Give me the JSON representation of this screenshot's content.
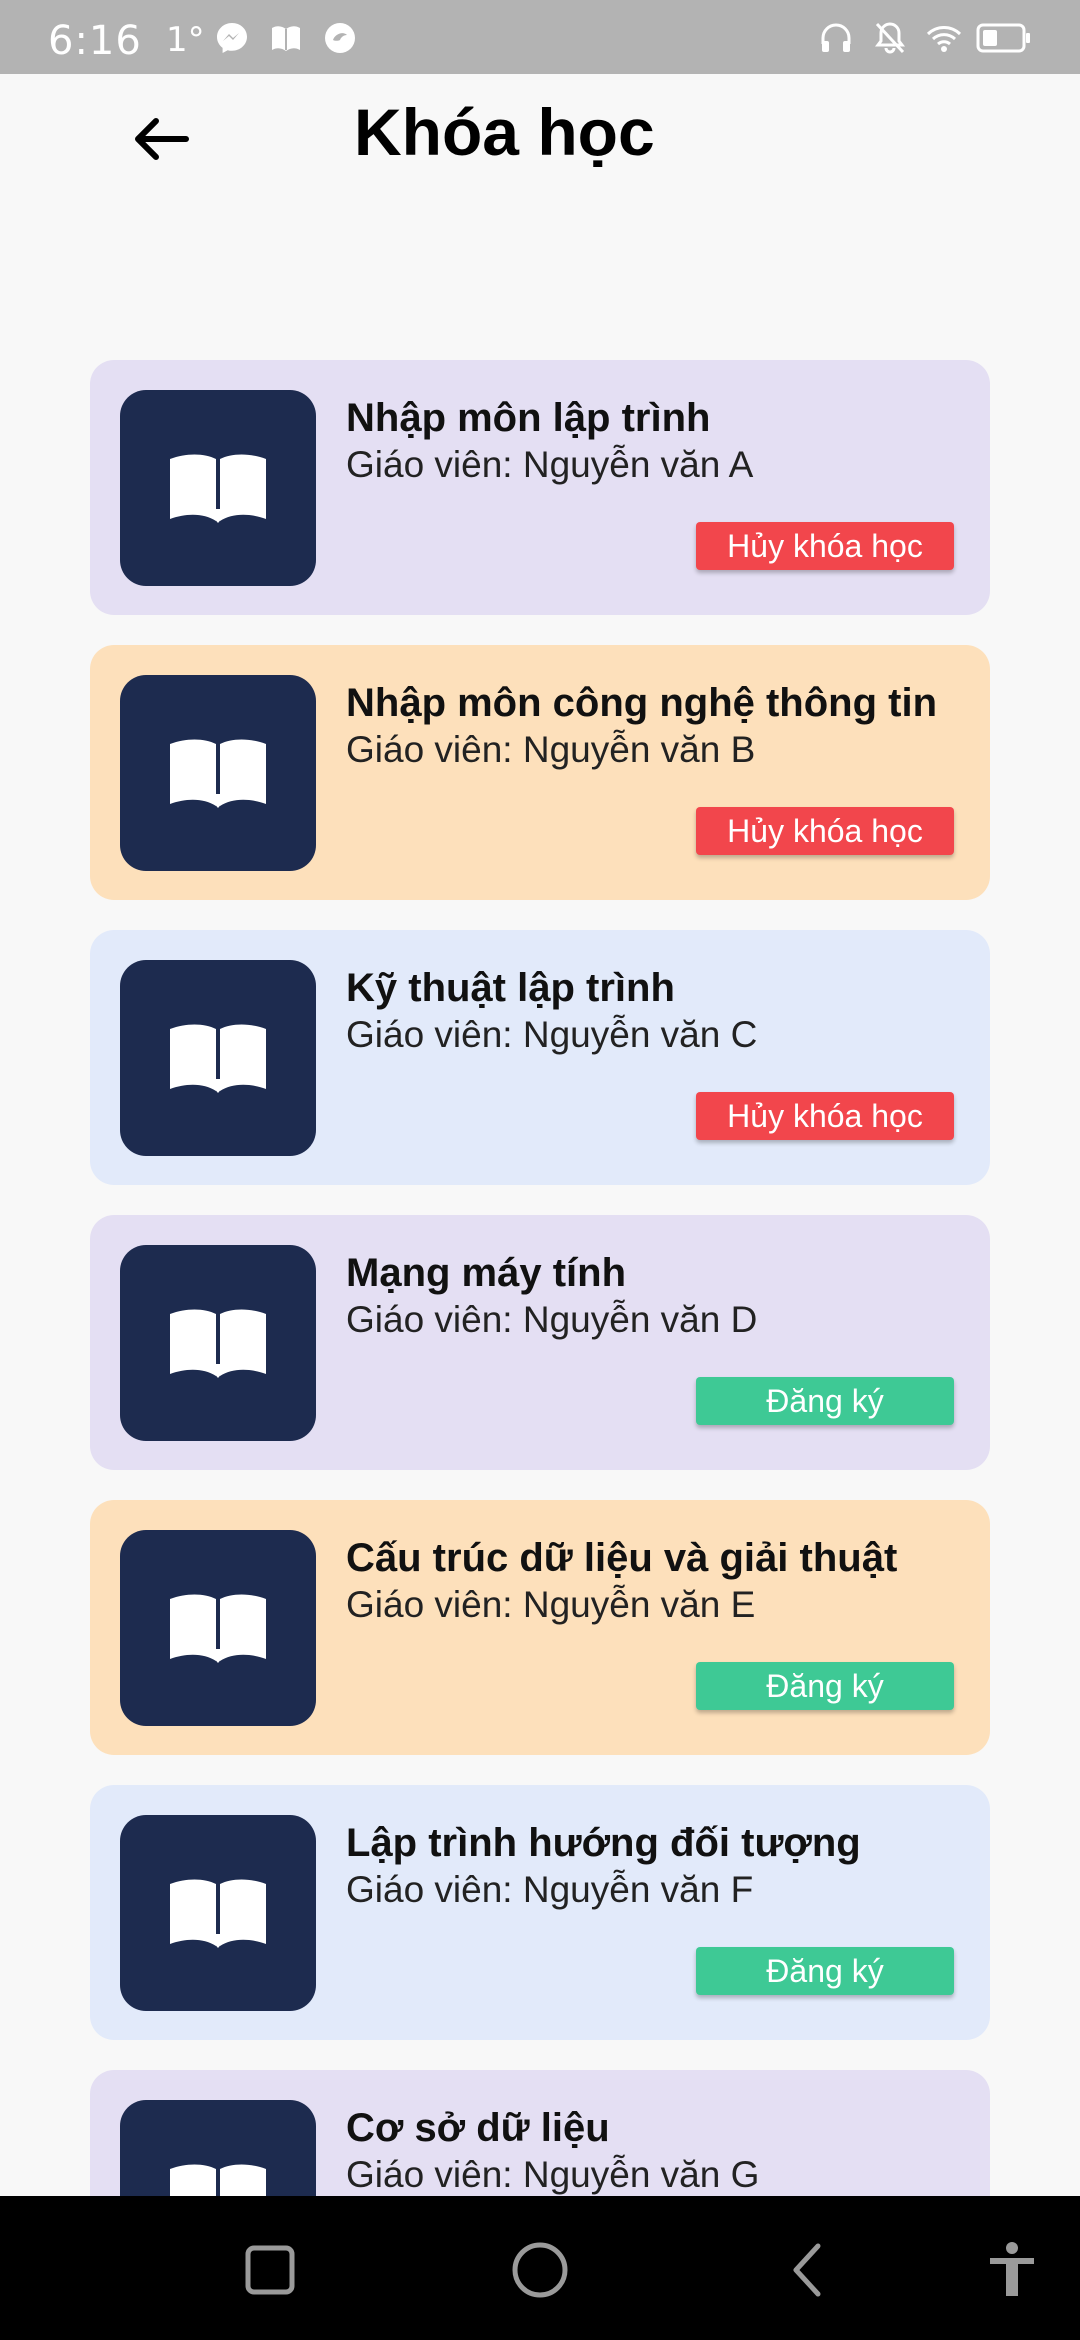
{
  "status_bar": {
    "time": "6:16",
    "temperature": "1°",
    "icons_left": [
      "messenger-icon",
      "book-icon",
      "chat-bubble-icon"
    ],
    "icons_right": [
      "headphones-icon",
      "muted-bell-icon",
      "wifi-icon",
      "battery-icon"
    ]
  },
  "header": {
    "title": "Khóa học",
    "back_icon": "arrow-left-icon"
  },
  "colors": {
    "card_purple": "#e4dff3",
    "card_orange": "#fde0bb",
    "card_blue": "#e2eafa",
    "thumb_bg": "#1d2b4f",
    "cancel_button": "#f2464c",
    "register_button": "#3ec995"
  },
  "courses": [
    {
      "name": "Nhập môn lập trình",
      "teacher": "Giáo viên: Nguyễn văn A",
      "action": "Hủy khóa học",
      "action_type": "cancel",
      "color": "#e4dff3"
    },
    {
      "name": "Nhập môn công nghệ thông tin",
      "teacher": "Giáo viên: Nguyễn văn B",
      "action": "Hủy khóa học",
      "action_type": "cancel",
      "color": "#fde0bb"
    },
    {
      "name": "Kỹ thuật lập trình",
      "teacher": "Giáo viên: Nguyễn văn C",
      "action": "Hủy khóa học",
      "action_type": "cancel",
      "color": "#e2eafa"
    },
    {
      "name": "Mạng máy tính",
      "teacher": "Giáo viên: Nguyễn văn D",
      "action": "Đăng ký",
      "action_type": "register",
      "color": "#e4dff3"
    },
    {
      "name": "Cấu trúc dữ liệu và giải thuật",
      "teacher": "Giáo viên: Nguyễn văn E",
      "action": "Đăng ký",
      "action_type": "register",
      "color": "#fde0bb"
    },
    {
      "name": "Lập trình hướng đối tượng",
      "teacher": "Giáo viên: Nguyễn văn F",
      "action": "Đăng ký",
      "action_type": "register",
      "color": "#e2eafa"
    },
    {
      "name": "Cơ sở dữ liệu",
      "teacher": "Giáo viên: Nguyễn văn G",
      "action": "",
      "action_type": "",
      "color": "#e4dff3"
    }
  ],
  "nav_bar": {
    "icons": [
      "recent-apps-icon",
      "home-icon",
      "back-icon",
      "accessibility-icon"
    ]
  }
}
